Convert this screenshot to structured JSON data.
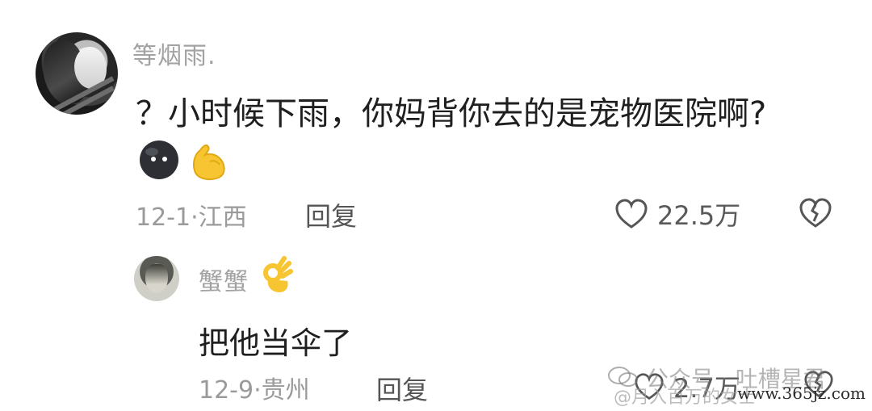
{
  "comments": {
    "main": {
      "username": "等烟雨.",
      "text": "？小时候下雨，你妈背你去的是宠物医院啊?",
      "reactions": [
        "round-black-blob-emoji",
        "flexed-biceps-emoji"
      ],
      "meta": "12-1·江西",
      "reply_label": "回复",
      "likes": "22.5万",
      "like_icon": "heart-outline-icon",
      "dislike_icon": "broken-heart-icon"
    },
    "reply": {
      "username": "蟹蟹",
      "username_emoji": "ok-hand-emoji",
      "text": "把他当伞了",
      "meta": "12-9·贵州",
      "reply_label": "回复",
      "likes": "2.7万",
      "like_icon": "heart-outline-icon",
      "dislike_icon": "broken-heart-icon"
    }
  },
  "watermark": {
    "line1": "公众号 · 吐槽星君",
    "line2": "@月入百万的女士",
    "url": "www.365jz.com"
  },
  "colors": {
    "username": "#a2a2a2",
    "text": "#1f1f1f",
    "meta": "#9a9a9a",
    "action": "#555555",
    "reaction_yellow": "#f7c531",
    "reaction_black": "#2d2f34"
  }
}
